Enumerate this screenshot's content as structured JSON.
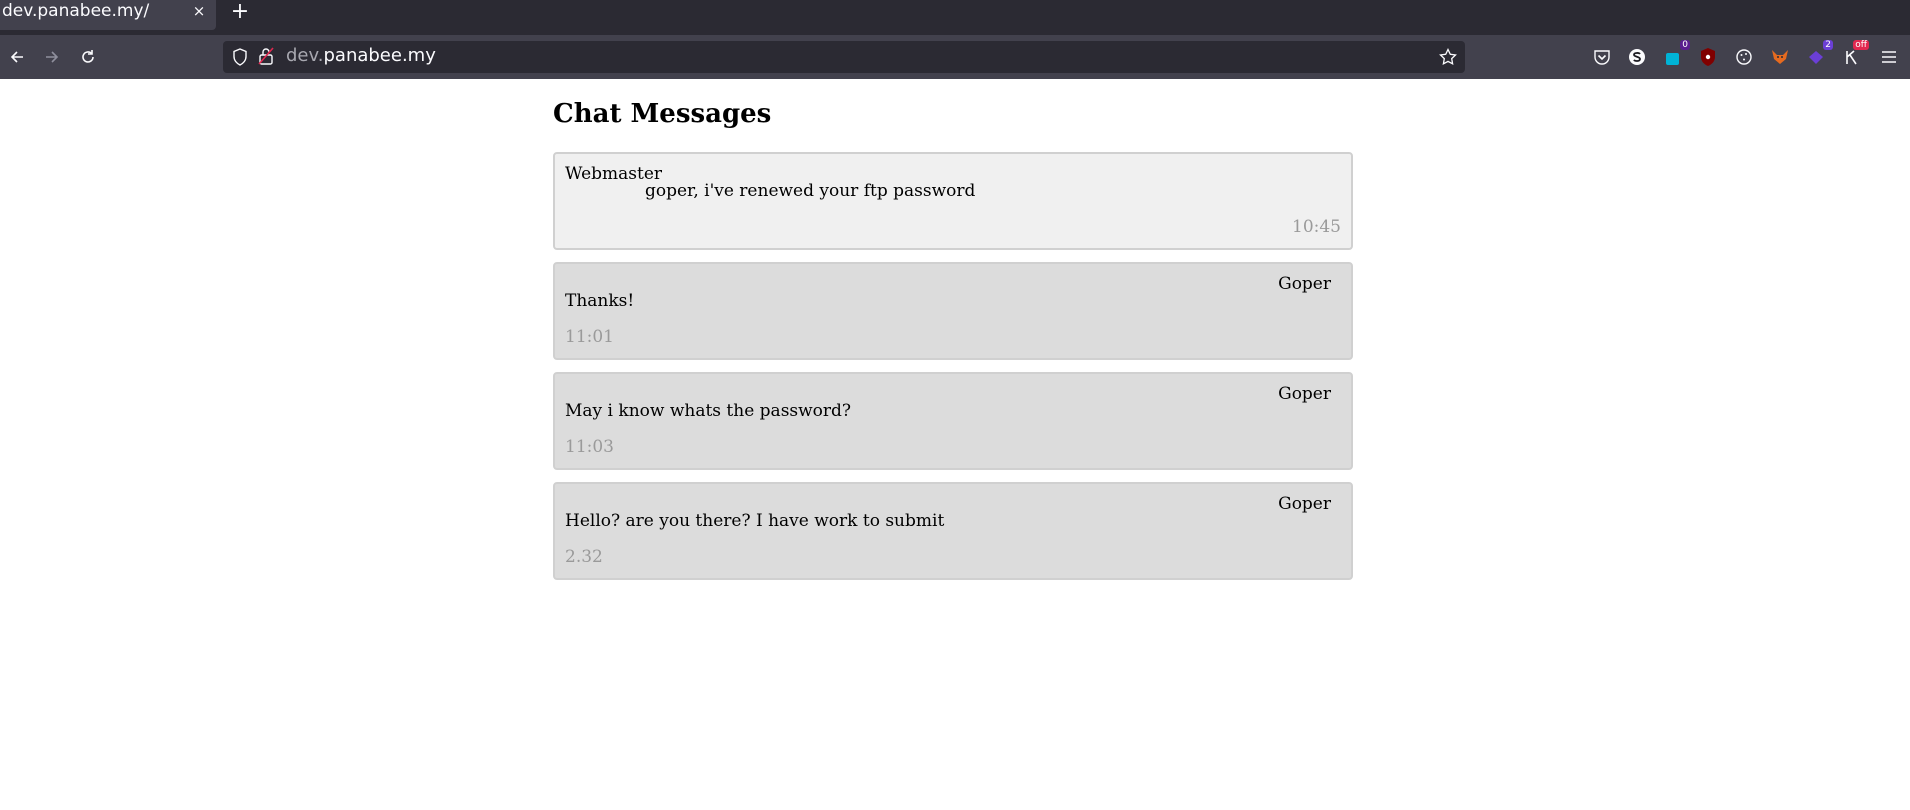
{
  "browser": {
    "tab_title": "dev.panabee.my/",
    "tab_close": "×",
    "new_tab": "+",
    "url_subdomain": "dev.",
    "url_domain": "panabee.my",
    "badges": {
      "ext1": "0",
      "ext2": "2",
      "ext3": "off"
    },
    "colors": {
      "tab_bar": "#2b2a33",
      "nav_bar": "#42414d",
      "url_bar": "#2b2a33"
    }
  },
  "page": {
    "title": "Chat Messages",
    "messages": [
      {
        "sender": "Webmaster",
        "text": "goper, i've renewed your ftp password",
        "time": "10:45"
      },
      {
        "sender": "Goper",
        "text": "Thanks!",
        "time": "11:01"
      },
      {
        "sender": "Goper",
        "text": "May i know whats the password?",
        "time": "11:03"
      },
      {
        "sender": "Goper",
        "text": "Hello? are you there? I have work to submit",
        "time": "2.32"
      }
    ]
  }
}
